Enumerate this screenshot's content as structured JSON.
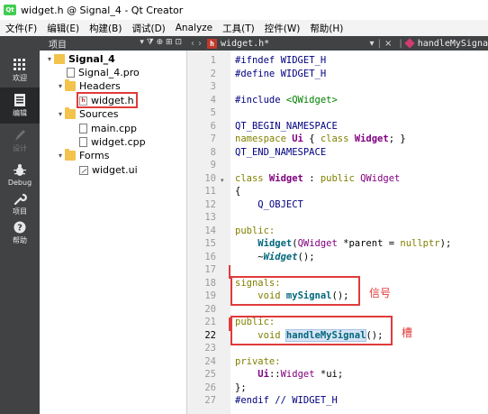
{
  "window": {
    "icon_label": "Qt",
    "title": "widget.h @ Signal_4 - Qt Creator"
  },
  "menubar": [
    "文件(F)",
    "编辑(E)",
    "构建(B)",
    "调试(D)",
    "Analyze",
    "工具(T)",
    "控件(W)",
    "帮助(H)"
  ],
  "modes": [
    {
      "label": "欢迎",
      "icon": "grid-icon"
    },
    {
      "label": "编辑",
      "icon": "edit-doc-icon",
      "active": true
    },
    {
      "label": "设计",
      "icon": "pen-icon",
      "disabled": true
    },
    {
      "label": "Debug",
      "icon": "bug-icon"
    },
    {
      "label": "项目",
      "icon": "wrench-icon"
    },
    {
      "label": "帮助",
      "icon": "help-icon"
    }
  ],
  "projects_panel": {
    "title": "项目",
    "tools": "▾ ⧩ ⊕ ⊞ ⊡"
  },
  "tree": {
    "project": "Signal_4",
    "pro_file": "Signal_4.pro",
    "headers": "Headers",
    "header_file": "widget.h",
    "sources": "Sources",
    "source_files": [
      "main.cpp",
      "widget.cpp"
    ],
    "forms": "Forms",
    "form_file": "widget.ui"
  },
  "editor": {
    "nav_left": "‹",
    "nav_right": "›",
    "file_badge": "h",
    "file_tab": "widget.h*",
    "tab_dropdown": "▾",
    "tab_close": "×",
    "symbol": "handleMySigna",
    "current_line": 22,
    "line_numbers": [
      "1",
      "2",
      "3",
      "4",
      "5",
      "6",
      "7",
      "8",
      "9",
      "10",
      "11",
      "12",
      "13",
      "14",
      "15",
      "16",
      "17",
      "18",
      "19",
      "20",
      "21",
      "22",
      "23",
      "24",
      "25",
      "26",
      "27"
    ],
    "fold_marker": "▾"
  },
  "code": {
    "l1_a": "#ifndef",
    "l1_b": " WIDGET_H",
    "l2_a": "#define",
    "l2_b": " WIDGET_H",
    "l4_a": "#include",
    "l4_b": " <QWidget>",
    "l6": "QT_BEGIN_NAMESPACE",
    "l7_a": "namespace",
    "l7_b": " Ui",
    "l7_c": " { ",
    "l7_d": "class",
    "l7_e": " Widget",
    "l7_f": "; }",
    "l8": "QT_END_NAMESPACE",
    "l10_a": "class",
    "l10_b": " Widget",
    "l10_c": " : ",
    "l10_d": "public",
    "l10_e": " QWidget",
    "l11": "{",
    "l12": "    Q_OBJECT",
    "l14": "public:",
    "l15_a": "    ",
    "l15_b": "Widget",
    "l15_c": "(",
    "l15_d": "QWidget",
    "l15_e": " *parent = ",
    "l15_f": "nullptr",
    "l15_g": ");",
    "l16_a": "    ~",
    "l16_b": "Widget",
    "l16_c": "();",
    "l18": "signals:",
    "l19_a": "    ",
    "l19_b": "void",
    "l19_c": " ",
    "l19_d": "mySignal",
    "l19_e": "();",
    "l21": "public:",
    "l22_a": "    ",
    "l22_b": "void",
    "l22_c": " ",
    "l22_d": "handleMySignal",
    "l22_e": "();",
    "l24": "private:",
    "l25_a": "    ",
    "l25_b": "Ui",
    "l25_c": "::",
    "l25_d": "Widget",
    "l25_e": " *ui;",
    "l26": "};",
    "l27_a": "#endif",
    "l27_b": " // WIDGET_H"
  },
  "annotations": {
    "signal_note": "信号",
    "slot_note": "槽"
  },
  "colors": {
    "annotation_red": "#e03b3b",
    "mode_bar": "#404244",
    "keyword": "#808000",
    "type": "#800080",
    "function": "#00677c"
  }
}
